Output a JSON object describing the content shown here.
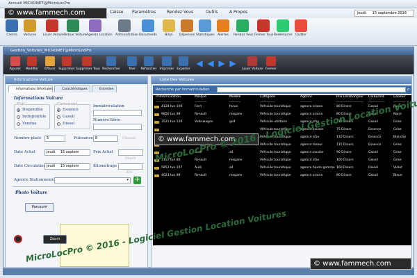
{
  "window": {
    "title": "Accueil MICRONET@MicroLocPro"
  },
  "watermarks": {
    "site": "© www.fammech.com",
    "overlay": "MicroLocPro © 2016 - Logiciel Gestion Location Voitures"
  },
  "menu": [
    "Caisse",
    "Paramètres",
    "Rendez Vous",
    "Outils",
    "A Propos"
  ],
  "date": {
    "day": "jeudi",
    "value": "15 septembre 2016"
  },
  "ribbon": [
    "Clients",
    "Voitures",
    "Louer Voiture",
    "Retour Voiture",
    "Agenda Location",
    "Administration",
    "Documents",
    "Bilan",
    "Dépenses",
    "Statistiques",
    "Alertes",
    "Rendez Vous",
    "Fermer Tous",
    "Redémarrer",
    "Quitter"
  ],
  "subwindow": {
    "title": "Gestion_Voitures_MICRONET@MicroLocPro"
  },
  "toolbar": [
    "Ajouter",
    "Modifier",
    "Effacer",
    "Supprimer",
    "Supprimer Tous",
    "Rechercher",
    "Trier",
    "Refraicher",
    "Imprimer",
    "Exporter",
    "Louer Voiture",
    "Fermer"
  ],
  "left": {
    "header": "Informations Voiture",
    "tabs": [
      "Informations Générales",
      "Caractéristiques",
      "Entretien"
    ],
    "section_title": "Informations Voiture",
    "etat": {
      "label": "Etat",
      "options": [
        "Disponible",
        "Indisponible",
        "Vendue"
      ],
      "selected": "Disponible"
    },
    "carburant": {
      "label": "Carburant",
      "options": [
        "Essence",
        "Gasoil",
        "Diesel"
      ],
      "selected": "Essence"
    },
    "immatriculation_label": "Immatriculation",
    "numero_serie_label": "Numéro Série",
    "nombre_place": {
      "label": "Nombre place",
      "value": "5"
    },
    "puissance": {
      "label": "Puissance",
      "value": "8",
      "unit": "Chevaux"
    },
    "date_achat": {
      "label": "Date Achat",
      "day": "jeudi",
      "date": "15 septem"
    },
    "prix_achat": {
      "label": "Prix Achat",
      "unit": "Dinars"
    },
    "date_circulation": {
      "label": "Date Circulation",
      "day": "jeudi",
      "date": "15 septem"
    },
    "kilometrage": {
      "label": "Kilométrage",
      "unit": "Km"
    },
    "agence_label": "Agence Stationnement",
    "photo_title": "Photo Voiture",
    "parcourir": "Parcourir",
    "zoom": "Zoom"
  },
  "right": {
    "header": "Liste Des Voitures",
    "search_label": "Recherche par Immatriculation",
    "columns": [
      "Immatriculation",
      "Marque",
      "Modèle",
      "Catégorie",
      "Agence",
      "Prix Location/Jour",
      "Carburant",
      "Couleur"
    ],
    "rows": [
      [
        "4128 tun 109",
        "Ford",
        "focus",
        "Véhicule touristique",
        "agence ariana",
        "80 Dinars",
        "Gasoil",
        "Jaune"
      ],
      [
        "9856 tun 98",
        "Renault",
        "megane",
        "Véhicule touristique",
        "agence ariana",
        "80 Dinars",
        "Gasoil",
        "Noire"
      ],
      [
        "3521 tun 120",
        "Volkswagen",
        "golf",
        "Véhicule utilitaire",
        "agence sfax",
        "110 Dinars",
        "Gasoil",
        "Grise"
      ],
      [
        "",
        "",
        "",
        "Véhicule touristique",
        "agence sousse",
        "75 Dinars",
        "Essence",
        "Grise"
      ],
      [
        "8521 tun 77",
        "Renault",
        "megane",
        "Véhicule touristique",
        "agence sfax",
        "110 Dinars",
        "Essence",
        "Blanche"
      ],
      [
        "",
        "Renault",
        "symbol",
        "Véhicule touristique",
        "agence tozeur",
        "115 Dinars",
        "Essence",
        "Grise"
      ],
      [
        "",
        "Audi",
        "a4",
        "Véhicule touristique",
        "agence sousse",
        "90 Dinars",
        "Gasoil",
        "Grise"
      ],
      [
        "1112 tun 86",
        "Renault",
        "megane",
        "Véhicule touristique",
        "agence sfax",
        "100 Dinars",
        "Gasoil",
        "Grise"
      ],
      [
        "5852 tun 107",
        "Audi",
        "a4",
        "Véhicule touristique",
        "agence haute gamme",
        "160 Dinars",
        "Diesel",
        "Violet"
      ],
      [
        "4023 tun 98",
        "Renault",
        "megane",
        "Véhicule touristique",
        "agence ariana",
        "80 Dinars",
        "Gasoil",
        "Bleue"
      ]
    ]
  }
}
